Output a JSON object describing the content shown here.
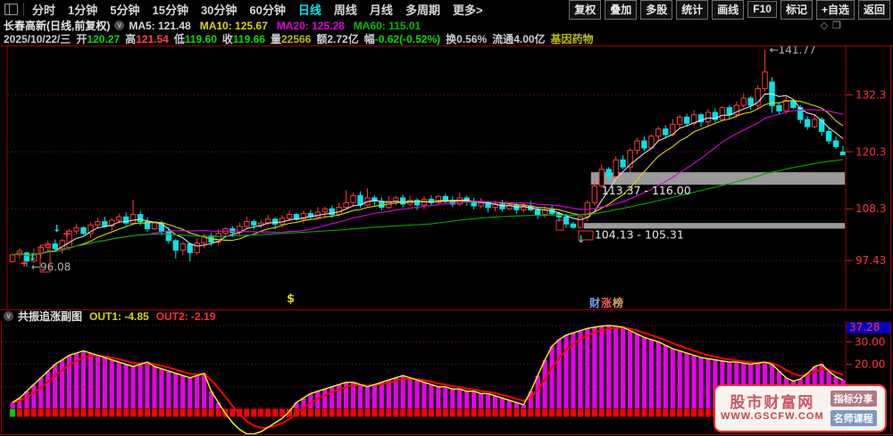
{
  "toolbar": {
    "periods": [
      "分时",
      "1分钟",
      "5分钟",
      "15分钟",
      "30分钟",
      "60分钟",
      "日线",
      "周线",
      "月线",
      "多周期",
      "更多>"
    ],
    "active_period": "日线",
    "right_buttons": [
      "复权",
      "叠加",
      "多股",
      "统计",
      "画线",
      "F10",
      "标记",
      "+自选",
      "返回"
    ]
  },
  "header": {
    "stock_title": "长春高新(日线,前复权)",
    "ma_values": [
      {
        "t": "MA5: 121.48",
        "c": "#d8d8d8"
      },
      {
        "t": "MA10: 125.67",
        "c": "#d8d800"
      },
      {
        "t": "MA20: 125.28",
        "c": "#e000e0"
      },
      {
        "t": "MA60: 115.01",
        "c": "#00bb00"
      }
    ],
    "corner_icons": [
      "◇",
      "❐"
    ]
  },
  "info_fields": [
    {
      "label": "",
      "lc": "#cfcfcf",
      "value": "2025/10/22/三",
      "vc": "#cfcfcf"
    },
    {
      "label": "开",
      "lc": "#cfcfcf",
      "value": "120.27",
      "vc": "#00dd00"
    },
    {
      "label": "高",
      "lc": "#cfcfcf",
      "value": "121.54",
      "vc": "#ff4343"
    },
    {
      "label": "低",
      "lc": "#cfcfcf",
      "value": "119.60",
      "vc": "#00dd00"
    },
    {
      "label": "收",
      "lc": "#cfcfcf",
      "value": "119.66",
      "vc": "#00dd00"
    },
    {
      "label": "量",
      "lc": "#cfcfcf",
      "value": "22566",
      "vc": "#bcbc00"
    },
    {
      "label": "额",
      "lc": "#cfcfcf",
      "value": "2.72亿",
      "vc": "#cfcfcf"
    },
    {
      "label": "幅",
      "lc": "#cfcfcf",
      "value": "-0.62(-0.52%)",
      "vc": "#00dd00"
    },
    {
      "label": "换",
      "lc": "#cfcfcf",
      "value": "0.56%",
      "vc": "#cfcfcf"
    },
    {
      "label": "流通",
      "lc": "#cfcfcf",
      "value": "4.00亿",
      "vc": "#cfcfcf"
    },
    {
      "label": "基因药物",
      "lc": "#bcbc00",
      "value": "",
      "vc": "#bcbc00"
    }
  ],
  "sub_header": {
    "title": "共振追涨副图",
    "out1": {
      "t": "OUT1: -4.85",
      "c": "#d8d800"
    },
    "out2": {
      "t": "OUT2: -2.19",
      "c": "#ff3030"
    }
  },
  "watermark": {
    "brand": "股市财富网",
    "url": "WWW.GSCFW.COM",
    "badge1": {
      "t": "指标分享",
      "c": "#b07a88"
    },
    "badge2": {
      "t": "名师课程",
      "c": "#7f97c4"
    }
  },
  "chart_data": [
    {
      "type": "candlestick",
      "panel": "main",
      "stock": "长春高新",
      "period": "日线",
      "ylim": [
        87.5,
        142.5
      ],
      "axis_values": [
        132.3,
        120.3,
        108.3,
        97.43
      ],
      "axis_labels": [
        "132.3",
        "120.3",
        "108.3",
        "97.43"
      ],
      "up_color": "#ff3a3a",
      "down_color": "#00e5e5",
      "ma_periods": [
        5,
        10,
        20,
        60
      ],
      "ma_colors": [
        "#dcdcdc",
        "#d8d800",
        "#e000e0",
        "#00aa00"
      ],
      "grid_color": "#7a1212",
      "border_color": "#a00000",
      "bands": [
        {
          "low": 113.37,
          "high": 116.0,
          "label": "113.37 - 116.00",
          "start_bar": 82
        },
        {
          "low": 104.13,
          "high": 105.31,
          "label": "104.13 - 105.31",
          "start_bar": 81
        }
      ],
      "annotations": {
        "peak_label": "←141.77",
        "peak_bar": 106,
        "peak_price": 141.77,
        "low_label": "←96.08",
        "low_bar": 2,
        "low_price": 96.08,
        "dollar": "$",
        "dollar_bar": 39,
        "brand_chars": [
          {
            "t": "财",
            "c": "#7a9aff"
          },
          {
            "t": "涨",
            "c": "#ff5555"
          },
          {
            "t": "榜",
            "c": "#d8aa55"
          }
        ]
      },
      "signals": {
        "down_arrows": [
          [
            36,
            288
          ],
          [
            63,
            256
          ],
          [
            633,
            244
          ],
          [
            650,
            268
          ]
        ],
        "plus_marks": [
          [
            26,
            295
          ],
          [
            74,
            262
          ]
        ],
        "boxes": [
          [
            45,
            275,
            11,
            30
          ],
          [
            623,
            247,
            8,
            11
          ],
          [
            648,
            259,
            16,
            10
          ]
        ],
        "arrow_color": "#00e5e5",
        "plus_color": "#ff4040",
        "box_color": "#ff3030"
      },
      "candles": [
        [
          97.2,
          98.6
        ],
        [
          98.6,
          99.4
        ],
        [
          99.0,
          97.3,
          96.08,
          99.3
        ],
        [
          97.3,
          98.9
        ],
        [
          98.9,
          100.2
        ],
        [
          100.2,
          100.9
        ],
        [
          100.9,
          99.9
        ],
        [
          99.9,
          101.6
        ],
        [
          100.2,
          103.6,
          99.6,
          104.1
        ],
        [
          103.6,
          104.3
        ],
        [
          104.3,
          103.1
        ],
        [
          103.1,
          104.9
        ],
        [
          104.9,
          105.6
        ],
        [
          105.6,
          104.7
        ],
        [
          104.7,
          105.9
        ],
        [
          105.9,
          106.6
        ],
        [
          106.6,
          105.3
        ],
        [
          105.3,
          107.1,
          104.9,
          110.2
        ],
        [
          107.1,
          105.6
        ],
        [
          105.6,
          104.1
        ],
        [
          104.1,
          105.3
        ],
        [
          105.3,
          103.6
        ],
        [
          103.6,
          101.6
        ],
        [
          101.6,
          99.6,
          97.8,
          102.0
        ],
        [
          99.6,
          100.9
        ],
        [
          100.9,
          99.1,
          97.2,
          101.2
        ],
        [
          99.1,
          101.1
        ],
        [
          101.1,
          102.6
        ],
        [
          102.6,
          101.3
        ],
        [
          101.3,
          103.1
        ],
        [
          103.1,
          104.1
        ],
        [
          104.1,
          103.3
        ],
        [
          103.3,
          104.6
        ],
        [
          104.6,
          105.6
        ],
        [
          105.6,
          104.9
        ],
        [
          104.9,
          105.3
        ],
        [
          105.3,
          106.1
        ],
        [
          106.1,
          105.1
        ],
        [
          105.1,
          106.3
        ],
        [
          106.3,
          107.1
        ],
        [
          107.1,
          106.1
        ],
        [
          106.1,
          107.3
        ],
        [
          107.3,
          106.6
        ],
        [
          106.6,
          107.6
        ],
        [
          107.6,
          108.3
        ],
        [
          108.3,
          107.1
        ],
        [
          107.1,
          108.6
        ],
        [
          108.6,
          109.6,
          108.2,
          112.2
        ],
        [
          109.6,
          111.1
        ],
        [
          111.1,
          109.1
        ],
        [
          109.1,
          110.6,
          108.8,
          112.6
        ],
        [
          110.6,
          109.9
        ],
        [
          109.9,
          108.6
        ],
        [
          108.6,
          109.9
        ],
        [
          109.9,
          110.6
        ],
        [
          110.6,
          109.3
        ],
        [
          109.3,
          110.1
        ],
        [
          110.1,
          109.1
        ],
        [
          109.1,
          110.3
        ],
        [
          110.3,
          109.6
        ],
        [
          109.6,
          110.9
        ],
        [
          110.9,
          110.1
        ],
        [
          110.1,
          109.3
        ],
        [
          109.3,
          110.6
        ],
        [
          110.6,
          109.9
        ],
        [
          109.9,
          108.9
        ],
        [
          108.9,
          109.6
        ],
        [
          109.6,
          108.6
        ],
        [
          108.6,
          109.3
        ],
        [
          109.3,
          108.3
        ],
        [
          108.3,
          109.1
        ],
        [
          109.1,
          108.1
        ],
        [
          108.1,
          108.9
        ],
        [
          108.9,
          108.1
        ],
        [
          108.1,
          107.1
        ],
        [
          107.1,
          108.1
        ],
        [
          108.1,
          107.3
        ],
        [
          107.3,
          106.6
        ],
        [
          106.6,
          105.1
        ],
        [
          105.1,
          104.4,
          104.13,
          105.6
        ],
        [
          104.4,
          106.6
        ],
        [
          106.6,
          109.6
        ],
        [
          109.6,
          113.1
        ],
        [
          113.1,
          116.6
        ],
        [
          116.6,
          115.1
        ],
        [
          115.1,
          118.6
        ],
        [
          118.6,
          117.1
        ],
        [
          117.1,
          120.6
        ],
        [
          120.6,
          122.6
        ],
        [
          122.6,
          121.1
        ],
        [
          121.1,
          123.6
        ],
        [
          123.6,
          125.1
        ],
        [
          125.1,
          123.9
        ],
        [
          123.9,
          126.1
        ],
        [
          126.1,
          127.6
        ],
        [
          127.6,
          126.3
        ],
        [
          126.3,
          128.1
        ],
        [
          128.1,
          126.6
        ],
        [
          126.6,
          128.6
        ],
        [
          128.6,
          127.1
        ],
        [
          127.1,
          129.6
        ],
        [
          129.6,
          128.1
        ],
        [
          128.1,
          130.1
        ],
        [
          130.1,
          131.6
        ],
        [
          131.6,
          130.1
        ],
        [
          130.1,
          133.6
        ],
        [
          133.6,
          137.1,
          133.0,
          141.77
        ],
        [
          135.0,
          130.0,
          128.5,
          136.0
        ],
        [
          130.0,
          128.9
        ],
        [
          128.9,
          131.1
        ],
        [
          131.1,
          129.6
        ],
        [
          129.6,
          127.1
        ],
        [
          127.1,
          125.6
        ],
        [
          125.6,
          127.1
        ],
        [
          127.1,
          124.6
        ],
        [
          124.6,
          122.6
        ],
        [
          122.6,
          121.4
        ],
        [
          120.27,
          119.66,
          119.6,
          121.54
        ]
      ]
    },
    {
      "type": "bar",
      "panel": "indicator",
      "title": "共振追涨副图",
      "out1": -4.85,
      "out2": -2.19,
      "max_value": 37.28,
      "axis_labels": [
        "37.28",
        "30.00",
        "20.00"
      ],
      "grid_values": [
        37.28,
        30,
        20,
        10
      ],
      "bar_color": "#e800e8",
      "line1_color": "#ffff00",
      "line2_color": "#ff0000",
      "base_block_color": "#ff0000",
      "first_block_color": "#00cc00",
      "label_bg": "#0000bb",
      "values": [
        3,
        5,
        8,
        11,
        14,
        17,
        20,
        22,
        24,
        25,
        26,
        25,
        24,
        23,
        22,
        21,
        20,
        19,
        20,
        21,
        19,
        18,
        17,
        16,
        15,
        14,
        15,
        16,
        8,
        3,
        -2,
        -6,
        -9,
        -11,
        -11,
        -10,
        -8,
        -6,
        -4,
        -1,
        3,
        5,
        7,
        8,
        9,
        10,
        11,
        12,
        12,
        11,
        10,
        11,
        12,
        13,
        14,
        15,
        14,
        13,
        12,
        11,
        10,
        10,
        9,
        9,
        8,
        8,
        7,
        7,
        6,
        5,
        4,
        3,
        2,
        8,
        15,
        22,
        28,
        31,
        33,
        34,
        35,
        36,
        36.5,
        37,
        37.28,
        37,
        36.5,
        35,
        33.5,
        32,
        31,
        30,
        28.5,
        27,
        26,
        25,
        24,
        23,
        22.5,
        22,
        21.5,
        21,
        21,
        20.5,
        20,
        20.5,
        21,
        20,
        17,
        14,
        12.5,
        13.5,
        16,
        19,
        20,
        17,
        14.5,
        13
      ]
    }
  ]
}
